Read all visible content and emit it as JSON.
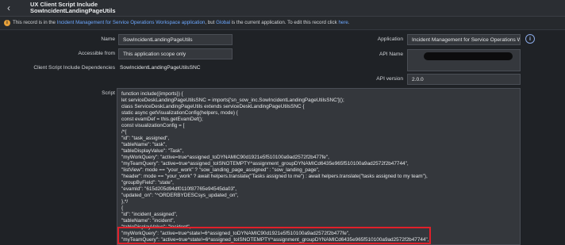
{
  "header": {
    "title": "UX Client Script Include",
    "subtitle": "SowIncidentLandingPageUtils",
    "back_icon": "chevron-left-icon"
  },
  "notice": {
    "prefix": "This record is in the ",
    "scope_link": "Incident Management for Service Operations Workspace application",
    "middle": ", but ",
    "global_link": "Global",
    "suffix": " is the current application. To edit this record click ",
    "here_link": "here",
    "end": "."
  },
  "form": {
    "name_label": "Name",
    "name_value": "SowIncidentLandingPageUtils",
    "accessible_label": "Accessible from",
    "accessible_value": "This application scope only",
    "deps_label": "Client Script Include Dependencies",
    "deps_value": "SowIncidentLandingPageUtilsSNC",
    "application_label": "Application",
    "application_value": "Incident Management for Service Operations Wor",
    "api_name_label": "API Name",
    "api_version_label": "API version",
    "api_version_value": "2.0.0",
    "script_label": "Script"
  },
  "script_lines": [
    "function include({imports}) {",
    "let serviceDeskLandingPageUtilsSNC = imports['sn_sow_inc.SowIncidentLandingPageUtilsSNC']();",
    "class ServiceDeskLandingPageUtils extends serviceDeskLandingPageUtilsSNC {",
    "static async getVisualizationConfig(helpers, mode) {",
    "const evamDef = this.getEvamDef();",
    "const visualizationConfig = [",
    "/*{",
    "\"id\": \"task_assigned\",",
    "\"tableName\": \"task\",",
    "\"tableDisplayValue\": \"Task\",",
    "\"myWorkQuery\": \"active=true^assigned_toDYNAMIC90d1921e5f510100a9ad2572f2b477fe\",",
    "\"myTeamQuery\": \"active=true^assigned_toISNOTEMPTY^assignment_groupDYNAMICd6435e965f510100a9ad2572f2b47744\",",
    "\"listView\": mode == \"your_work\" ? \"sow_landing_page_assigned\" : \"sow_landing_page\",",
    "\"header\": mode == \"your_work\" ? await helpers.translate(\"Tasks assigned to me\") : await helpers.translate(\"tasks assigned to my team\"),",
    "\"groupByField\": \"state\",",
    "\"evamId\": \"615d205d94df0110f87765e94545da03\",",
    "\"updated_on\": \"^ORDERBYDESCsys_updated_on\",",
    "},*/",
    "{",
    "\"id\": \"incident_assigned\",",
    "\"tableName\": \"incident\",",
    "\"tableDisplayValue\": \"Incident\",",
    "\"myWorkQuery\": \"active=true^state!=6^assigned_toDYNAMIC90d1921e5f510100a9ad2572f2b477fe\",",
    "\"myTeamQuery\": \"active=true^state!=6^assigned_toISNOTEMPTY^assignment_groupDYNAMICd6435e965f510100a9ad2572f2b47744\","
  ]
}
